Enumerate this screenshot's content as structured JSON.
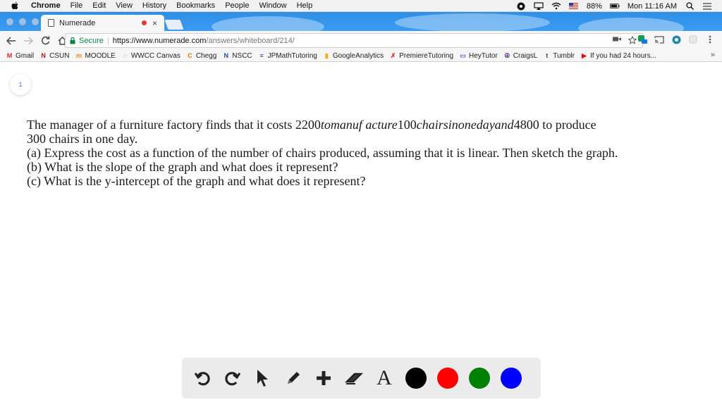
{
  "menubar": {
    "app_name": "Chrome",
    "items": [
      "File",
      "Edit",
      "View",
      "History",
      "Bookmarks",
      "People",
      "Window",
      "Help"
    ],
    "battery": "88%",
    "clock": "Mon 11:16 AM"
  },
  "tab": {
    "title": "Numerade",
    "close": "×"
  },
  "address_bar": {
    "secure_label": "Secure",
    "separator": "|",
    "url_scheme_host": "https://www.numerade.com",
    "url_path": "/answers/whiteboard/214/"
  },
  "bookmarks": [
    {
      "label": "Gmail",
      "icon": "gmail-icon",
      "glyph": "M",
      "color": "#d93025"
    },
    {
      "label": "CSUN",
      "icon": "csun-icon",
      "glyph": "N",
      "color": "#b31b1b"
    },
    {
      "label": "MOODLE",
      "icon": "moodle-icon",
      "glyph": "m",
      "color": "#f98012"
    },
    {
      "label": "WWCC Canvas",
      "icon": "canvas-icon",
      "glyph": "◌",
      "color": "#e22b28"
    },
    {
      "label": "Chegg",
      "icon": "chegg-icon",
      "glyph": "C",
      "color": "#eb7100"
    },
    {
      "label": "NSCC",
      "icon": "nscc-icon",
      "glyph": "N",
      "color": "#1f4e9c"
    },
    {
      "label": "JPMathTutoring",
      "icon": "jpmath-icon",
      "glyph": "≡",
      "color": "#2b4a9c"
    },
    {
      "label": "GoogleAnalytics",
      "icon": "analytics-icon",
      "glyph": "▮",
      "color": "#f9ab00"
    },
    {
      "label": "PremiereTutoring",
      "icon": "premiere-icon",
      "glyph": "✗",
      "color": "#c0392b"
    },
    {
      "label": "HeyTutor",
      "icon": "heytutor-icon",
      "glyph": "▭",
      "color": "#3b6fd6"
    },
    {
      "label": "CraigsL",
      "icon": "craigslist-icon",
      "glyph": "☮",
      "color": "#5b2a86"
    },
    {
      "label": "Tumblr",
      "icon": "tumblr-icon",
      "glyph": "t",
      "color": "#36465d"
    },
    {
      "label": "If you had 24 hours...",
      "icon": "youtube-icon",
      "glyph": "▶",
      "color": "#ff0000"
    }
  ],
  "bookmarks_more": "»",
  "page": {
    "page_number": "1",
    "problem": {
      "line1_prefix": "The manager of a furniture factory finds that it costs 2200",
      "line1_italic": "tomanuf acture",
      "line1_mid": "100",
      "line1_italic2": "chairsinonedayand",
      "line1_suffix": "4800 to produce",
      "line2": "300 chairs in one day.",
      "line3": "(a) Express the cost as a function of the number of chairs produced, assuming that it is linear. Then sketch the graph.",
      "line4": "(b) What is the slope of the graph and what does it represent?",
      "line5": "(c) What is the y-intercept of the graph and what does it represent?"
    }
  },
  "tools": {
    "colors": [
      "#000000",
      "#ff0000",
      "#008000",
      "#0000ff"
    ],
    "text_tool_label": "A"
  }
}
